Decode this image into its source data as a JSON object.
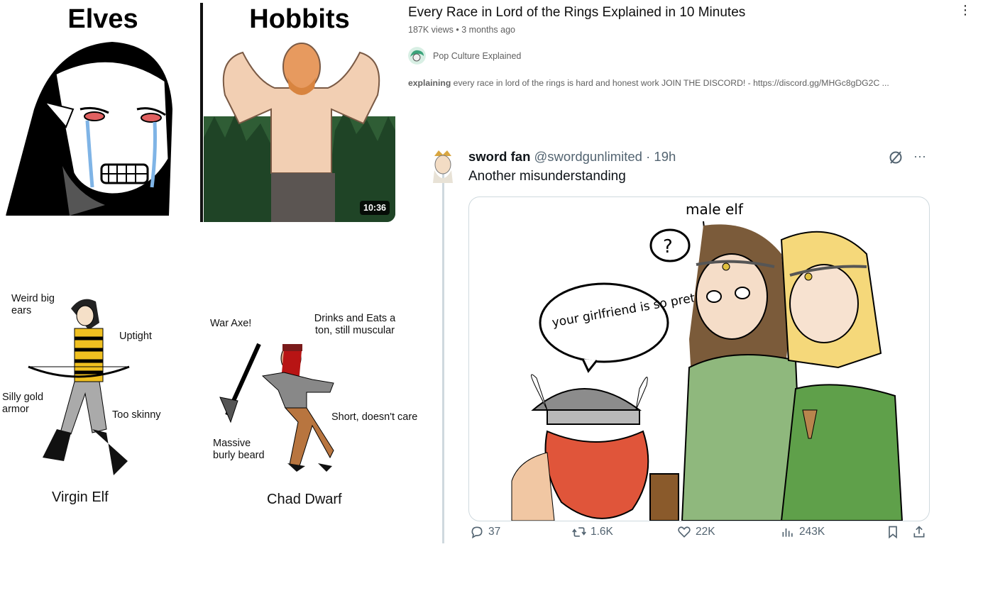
{
  "video": {
    "title": "Every Race in Lord of the Rings Explained in 10 Minutes",
    "meta": "187K views • 3 months ago",
    "channel": "Pop Culture Explained",
    "description_bold": "explaining",
    "description_rest": " every race in lord of the rings is hard and honest work JOIN THE DISCORD! - https://discord.gg/MHGc8gDG2C ...",
    "duration": "10:36",
    "thumbnail_left_caption": "Elves",
    "thumbnail_right_caption": "Hobbits",
    "menu_icon": "kebab-menu-icon"
  },
  "meme": {
    "elf": {
      "labels": {
        "ears": "Weird big ears",
        "uptight": "Uptight",
        "armor": "Silly gold armor",
        "skinny": "Too skinny"
      },
      "name": "Virgin Elf"
    },
    "dwarf": {
      "labels": {
        "axe": "War Axe!",
        "drinks": "Drinks and Eats a ton, still muscular",
        "short": "Short, doesn't care",
        "beard": "Massive burly beard"
      },
      "name": "Chad Dwarf"
    }
  },
  "tweet": {
    "author_name": "sword fan",
    "handle": "@swordgunlimited",
    "time": "· 19h",
    "text": "Another misunderstanding",
    "image_texts": {
      "top": "male elf",
      "bubble_question": "?",
      "bubble": "your girlfriend is so pretty!"
    },
    "actions": {
      "replies": "37",
      "reposts": "1.6K",
      "likes": "22K",
      "views": "243K"
    },
    "colors": {
      "text": "#0f1419",
      "muted": "#536471",
      "border": "#cfd9de"
    }
  }
}
